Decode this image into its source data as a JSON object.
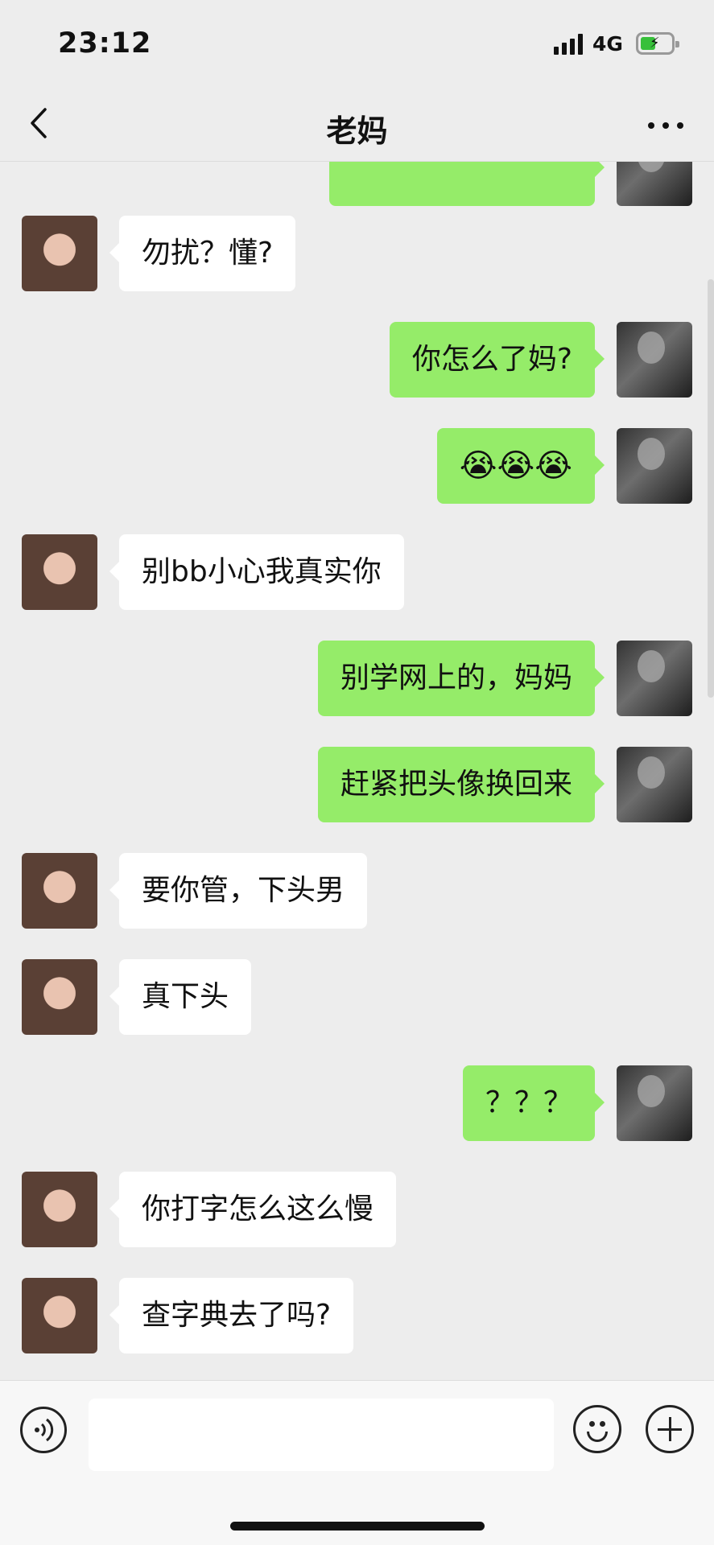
{
  "status_bar": {
    "time": "23:12",
    "network": "4G",
    "battery_state": "charging"
  },
  "nav": {
    "title": "老妈",
    "back_icon": "chevron-left-icon",
    "more_icon": "more-horizontal-icon"
  },
  "messages": [
    {
      "side": "in",
      "text": "勿扰？懂?"
    },
    {
      "side": "out",
      "text": "你怎么了妈?"
    },
    {
      "side": "out",
      "text": "😭😭😭"
    },
    {
      "side": "in",
      "text": "别bb小心我真实你"
    },
    {
      "side": "out",
      "text": "别学网上的，妈妈"
    },
    {
      "side": "out",
      "text": "赶紧把头像换回来"
    },
    {
      "side": "in",
      "text": "要你管，下头男"
    },
    {
      "side": "in",
      "text": "真下头"
    },
    {
      "side": "out",
      "text": "？？？"
    },
    {
      "side": "in",
      "text": "你打字怎么这么慢"
    },
    {
      "side": "in",
      "text": "查字典去了吗?"
    }
  ],
  "input_bar": {
    "placeholder": "",
    "voice_icon": "voice-icon",
    "emoji_icon": "emoji-icon",
    "plus_icon": "plus-icon"
  },
  "colors": {
    "background": "#ededed",
    "outgoing_bubble": "#95ec69",
    "incoming_bubble": "#ffffff"
  }
}
